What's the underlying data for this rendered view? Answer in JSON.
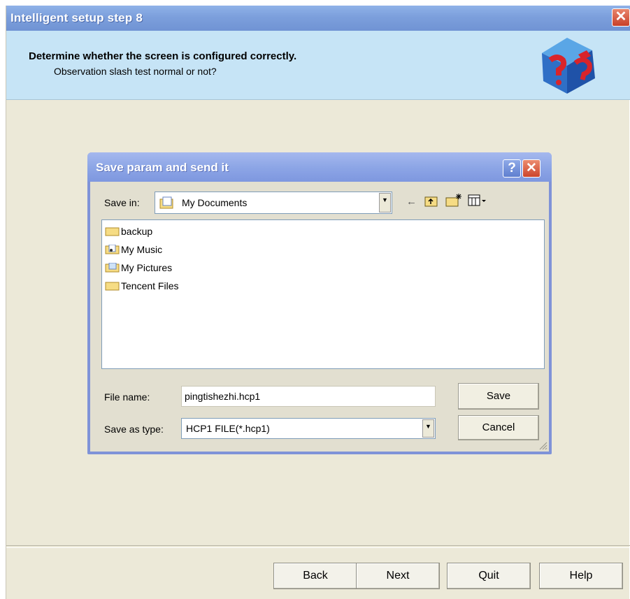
{
  "window": {
    "title": "Intelligent setup step 8",
    "close_glyph": "✕"
  },
  "header": {
    "heading": "Determine whether the screen is configured correctly.",
    "subheading": "Observation slash test normal or not?",
    "logo_icon": "question-cube-icon"
  },
  "dialog": {
    "title": "Save param and send it",
    "help_glyph": "?",
    "close_glyph": "✕",
    "save_in_label": "Save in:",
    "save_in_value": "My Documents",
    "toolbar_icons": [
      "back-arrow-icon",
      "up-folder-icon",
      "new-folder-icon",
      "view-menu-icon"
    ],
    "files": [
      {
        "name": "backup",
        "icon": "folder-icon"
      },
      {
        "name": "My Music",
        "icon": "music-folder-icon"
      },
      {
        "name": "My Pictures",
        "icon": "pictures-folder-icon"
      },
      {
        "name": "Tencent Files",
        "icon": "folder-icon"
      }
    ],
    "file_name_label": "File name:",
    "file_name_value": "pingtishezhi.hcp1",
    "save_type_label": "Save as type:",
    "save_type_value": "HCP1 FILE(*.hcp1)",
    "save_button": "Save",
    "cancel_button": "Cancel"
  },
  "footer": {
    "back": "Back",
    "next": "Next",
    "quit": "Quit",
    "help": "Help"
  },
  "colors": {
    "title_bar": "#7c9fdc",
    "header_band": "#c6e4f6",
    "window_bg": "#ece9d8",
    "dialog_border": "#7f93d8",
    "close_red": "#c8402a"
  }
}
